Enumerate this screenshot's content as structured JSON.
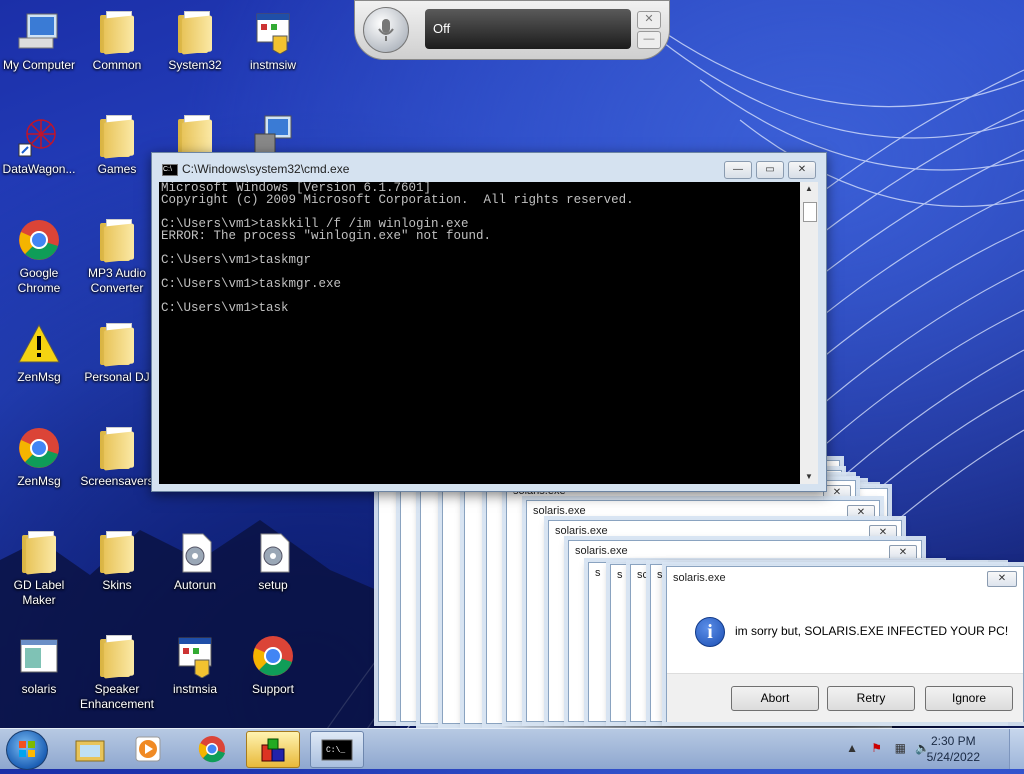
{
  "desktop_icons": [
    {
      "label": "My Computer",
      "icon": "computer-icon"
    },
    {
      "label": "Common",
      "icon": "folder-icon"
    },
    {
      "label": "System32",
      "icon": "folder-icon"
    },
    {
      "label": "instmsiw",
      "icon": "installer-icon"
    },
    {
      "label": "DataWagon...",
      "icon": "app-shortcut-icon"
    },
    {
      "label": "Games",
      "icon": "folder-icon"
    },
    {
      "label": "Google Chrome",
      "icon": "chrome-icon"
    },
    {
      "label": "MP3 Audio Converter",
      "icon": "folder-icon"
    },
    {
      "label": "ZenMsg",
      "icon": "warning-icon"
    },
    {
      "label": "Personal DJ",
      "icon": "folder-icon"
    },
    {
      "label": "ZenMsg",
      "icon": "chrome-icon"
    },
    {
      "label": "Screensavers",
      "icon": "folder-icon"
    },
    {
      "label": "GD Label Maker",
      "icon": "folder-icon"
    },
    {
      "label": "Skins",
      "icon": "folder-icon"
    },
    {
      "label": "Autorun",
      "icon": "settings-file-icon"
    },
    {
      "label": "setup",
      "icon": "settings-file-icon"
    },
    {
      "label": "solaris",
      "icon": "window-app-icon"
    },
    {
      "label": "Speaker Enhancement",
      "icon": "folder-icon"
    },
    {
      "label": "instmsia",
      "icon": "installer-icon"
    },
    {
      "label": "Support",
      "icon": "chrome-icon"
    }
  ],
  "speech": {
    "status": "Off"
  },
  "cmd": {
    "title": "C:\\Windows\\system32\\cmd.exe",
    "lines": [
      "Microsoft Windows [Version 6.1.7601]",
      "Copyright (c) 2009 Microsoft Corporation.  All rights reserved.",
      "",
      "C:\\Users\\vm1>taskkill /f /im winlogin.exe",
      "ERROR: The process \"winlogin.exe\" not found.",
      "",
      "C:\\Users\\vm1>taskmgr",
      "",
      "C:\\Users\\vm1>taskmgr.exe",
      "",
      "C:\\Users\\vm1>task"
    ]
  },
  "stacked_dialogs": {
    "title": "solaris.exe"
  },
  "dialog": {
    "title": "solaris.exe",
    "message": "im sorry but, SOLARIS.EXE INFECTED YOUR PC!",
    "buttons": [
      "Abort",
      "Retry",
      "Ignore"
    ],
    "close": "✕"
  },
  "taskbar": {
    "time": "2:30 PM",
    "date": "5/24/2022",
    "pinned": [
      "explorer-icon",
      "media-player-icon",
      "chrome-icon",
      "virus-app-icon",
      "cmd-icon"
    ]
  }
}
